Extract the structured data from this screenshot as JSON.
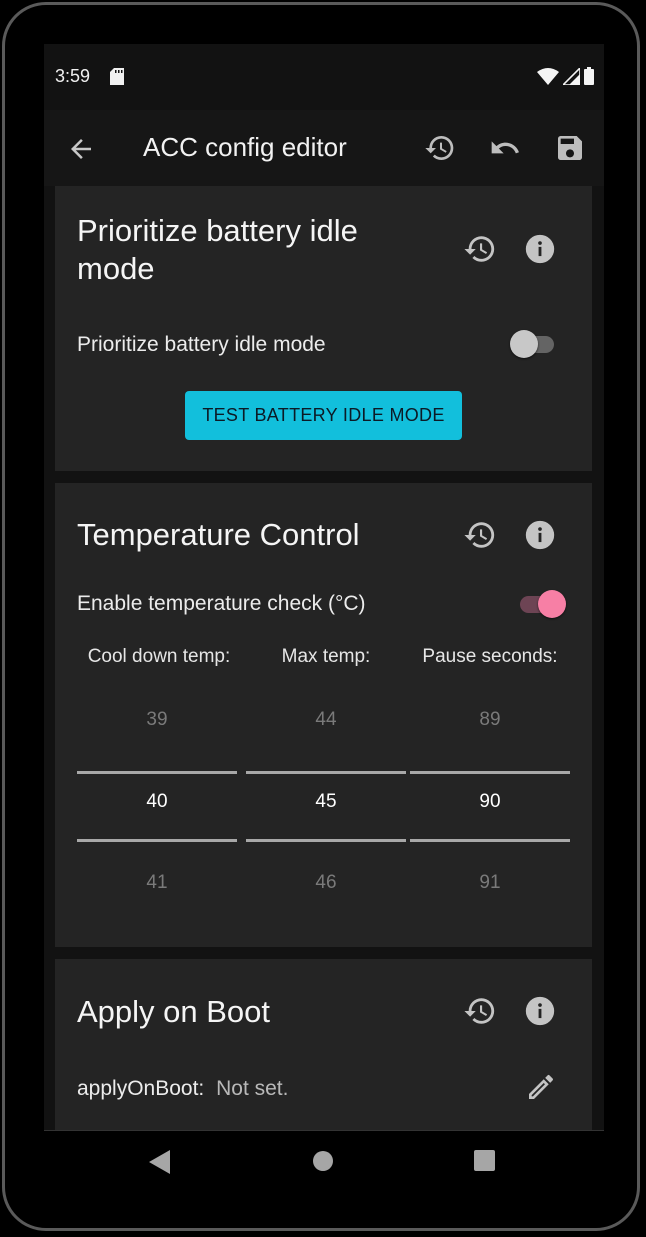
{
  "status_bar": {
    "time": "3:59",
    "icons": [
      "sd-card-icon",
      "wifi-icon",
      "cell-signal-icon",
      "battery-icon"
    ]
  },
  "app_bar": {
    "title": "ACC config editor",
    "actions": [
      "back-arrow-icon",
      "restore-history-icon",
      "undo-icon",
      "save-icon"
    ]
  },
  "colors": {
    "accent_button": "#12bfdc",
    "switch_on": "#f77fa5",
    "card_bg": "#242424",
    "screen_bg": "#121212"
  },
  "sections": [
    {
      "title": "Prioritize battery idle mode",
      "toggle_label": "Prioritize battery idle mode",
      "toggle_on": false,
      "button_label": "TEST BATTERY IDLE MODE"
    },
    {
      "title": "Temperature Control",
      "toggle_label": "Enable temperature check (°C)",
      "toggle_on": true,
      "pickers": [
        {
          "label": "Cool down temp:",
          "prev": "39",
          "value": "40",
          "next": "41"
        },
        {
          "label": "Max temp:",
          "prev": "44",
          "value": "45",
          "next": "46"
        },
        {
          "label": "Pause seconds:",
          "prev": "89",
          "value": "90",
          "next": "91"
        }
      ]
    },
    {
      "title": "Apply on Boot",
      "field_key": "applyOnBoot:",
      "field_value": "Not set."
    }
  ],
  "nav_bar": [
    "back-triangle-icon",
    "home-circle-icon",
    "recents-square-icon"
  ]
}
